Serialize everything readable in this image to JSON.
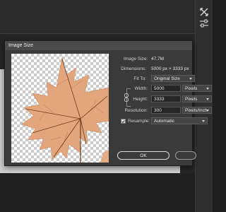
{
  "dialog": {
    "title": "Image Size",
    "image_size_label": "Image Size:",
    "image_size_value": "47.7M",
    "dimensions_label": "Dimensions:",
    "dimensions_value": "5000 px  ×  3333 px",
    "fit_to_label": "Fit To:",
    "fit_to_value": "Original Size",
    "width_label": "Width:",
    "width_value": "5000",
    "width_unit": "Pixels",
    "height_label": "Height:",
    "height_value": "3333",
    "height_unit": "Pixels",
    "resolution_label": "Resolution:",
    "resolution_value": "300",
    "resolution_unit": "Pixels/Inch",
    "resample_label": "Resample:",
    "resample_checked": true,
    "resample_value": "Automatic",
    "ok_label": "OK"
  },
  "icons": {
    "toolbar_top": "expand-arrows-icon",
    "toolbar_second": "sliders-icon",
    "constrain": "link-chain-icon",
    "checkmark": "checkmark-icon"
  },
  "colors": {
    "leaf_fill": "#e3a57c",
    "leaf_vein": "#6b3b1f",
    "dialog_bg": "#3a3a3a"
  }
}
